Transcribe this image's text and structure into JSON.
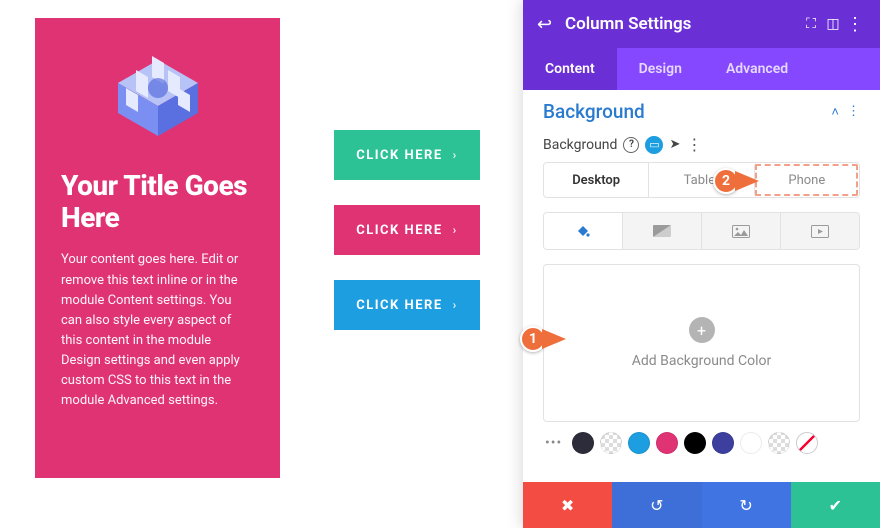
{
  "preview": {
    "title": "Your Title Goes Here",
    "body": "Your content goes here. Edit or remove this text inline or in the module Content settings. You can also style every aspect of this content in the module Design settings and even apply custom CSS to this text in the module Advanced settings."
  },
  "buttons": [
    {
      "label": "CLICK HERE",
      "color": "teal"
    },
    {
      "label": "CLICK HERE",
      "color": "pink"
    },
    {
      "label": "CLICK HERE",
      "color": "blue"
    }
  ],
  "panel": {
    "title": "Column Settings",
    "tabs": {
      "content": "Content",
      "design": "Design",
      "advanced": "Advanced",
      "active": "Content"
    },
    "section_title": "Background",
    "option_label": "Background",
    "device_tabs": {
      "desktop": "Desktop",
      "tablet": "Tablet",
      "phone": "Phone",
      "active": "Desktop"
    },
    "bg_box_label": "Add Background Color",
    "swatch_colors": [
      "#2d2c3a",
      "trans",
      "#1d9ee0",
      "#e03374",
      "#000000",
      "#3c3f9e",
      "#ffffff",
      "trans",
      "nonew"
    ]
  },
  "callouts": {
    "one": "1",
    "two": "2"
  }
}
